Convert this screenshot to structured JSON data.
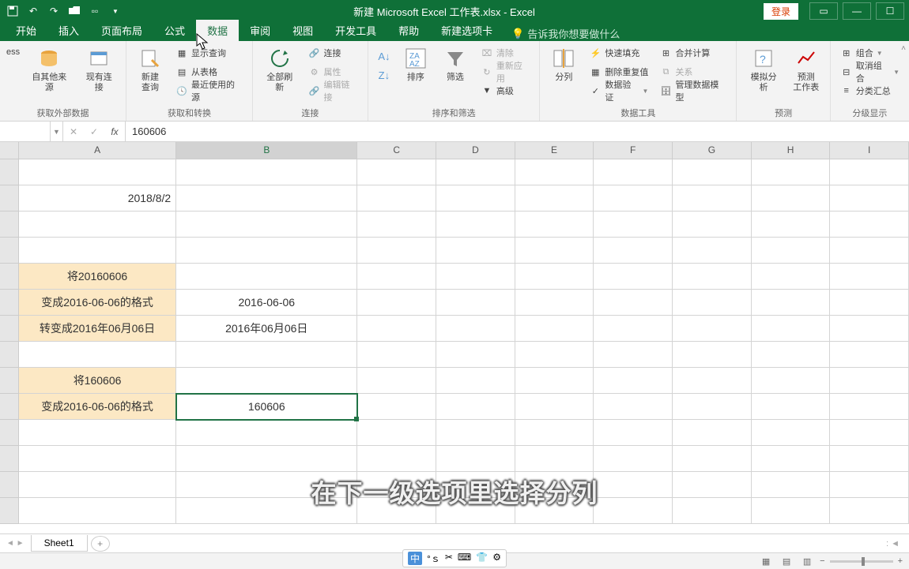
{
  "title": "新建 Microsoft Excel 工作表.xlsx  -  Excel",
  "login": "登录",
  "tabs": {
    "start": "开始",
    "insert": "插入",
    "layout": "页面布局",
    "formula": "公式",
    "data": "数据",
    "review": "审阅",
    "view": "视图",
    "dev": "开发工具",
    "help": "帮助",
    "newtab": "新建选项卡"
  },
  "tellme": "告诉我你想要做什么",
  "ribbon": {
    "g1": {
      "other": "自其他来源",
      "conn": "现有连接",
      "label": "获取外部数据",
      "ess": "ess"
    },
    "g2": {
      "newq": "新建\n查询",
      "showq": "显示查询",
      "fromtbl": "从表格",
      "recent": "最近使用的源",
      "label": "获取和转换"
    },
    "g3": {
      "refresh": "全部刷新",
      "conn": "连接",
      "prop": "属性",
      "editlink": "编辑链接",
      "label": "连接"
    },
    "g4": {
      "sort": "排序",
      "filter": "筛选",
      "clear": "清除",
      "reapply": "重新应用",
      "adv": "高级",
      "label": "排序和筛选"
    },
    "g5": {
      "split": "分列",
      "flash": "快速填充",
      "dedup": "删除重复值",
      "valid": "数据验证",
      "merge": "合并计算",
      "rel": "关系",
      "model": "管理数据模型",
      "label": "数据工具"
    },
    "g6": {
      "whatif": "模拟分析",
      "forecast": "预测\n工作表",
      "label": "预测"
    },
    "g7": {
      "group": "组合",
      "ungroup": "取消组合",
      "subtotal": "分类汇总",
      "label": "分级显示"
    }
  },
  "namebox": "",
  "formula": "160606",
  "cols": {
    "a_w": 200,
    "b_w": 230,
    "other_w": 100
  },
  "cells": {
    "a2": "2018/8/2",
    "a5": "将20160606",
    "a6": "变成2016-06-06的格式",
    "a7": "转变成2016年06月06日",
    "b6": "2016-06-06",
    "b7": "2016年06月06日",
    "a9": "将160606",
    "a10": "变成2016-06-06的格式",
    "b10": "160606"
  },
  "sheet": {
    "name": "Sheet1"
  },
  "caption": "在下一级选项里选择分列",
  "ime": {
    "zhong": "中",
    "dot": "°ｓ",
    "scissors": "✂",
    "kb": "⌨",
    "shirt": "👕",
    "gear": "⚙"
  }
}
